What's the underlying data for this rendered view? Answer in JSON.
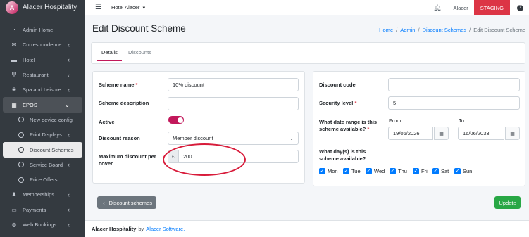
{
  "brand": {
    "name": "Alacer Hospitality"
  },
  "topbar": {
    "hotel": "Hotel Alacer",
    "user": "Alacer",
    "env_badge": "STAGING"
  },
  "sidebar": {
    "items": [
      {
        "label": "Admin Home",
        "icon": "gauge-icon"
      },
      {
        "label": "Correspondence",
        "icon": "envelope-icon"
      },
      {
        "label": "Hotel",
        "icon": "bed-icon"
      },
      {
        "label": "Restaurant",
        "icon": "utensils-icon"
      },
      {
        "label": "Spa and Leisure",
        "icon": "spa-icon"
      },
      {
        "label": "EPOS",
        "icon": "cash-register-icon"
      },
      {
        "label": "New device config",
        "icon": "circle-icon"
      },
      {
        "label": "Print Displays",
        "icon": "circle-icon"
      },
      {
        "label": "Discount Schemes",
        "icon": "circle-icon"
      },
      {
        "label": "Service Board",
        "icon": "circle-icon"
      },
      {
        "label": "Price Offers",
        "icon": "circle-icon"
      },
      {
        "label": "Memberships",
        "icon": "users-icon"
      },
      {
        "label": "Payments",
        "icon": "credit-card-icon"
      },
      {
        "label": "Web Bookings",
        "icon": "globe-icon"
      }
    ]
  },
  "page": {
    "title": "Edit Discount Scheme",
    "breadcrumb": [
      "Home",
      "Admin",
      "Discount Schemes",
      "Edit Discount Scheme"
    ]
  },
  "tabs": [
    "Details",
    "Discounts"
  ],
  "form_left": {
    "scheme_name_label": "Scheme name",
    "scheme_name_value": "10% discount",
    "scheme_description_label": "Scheme description",
    "scheme_description_value": "",
    "active_label": "Active",
    "discount_reason_label": "Discount reason",
    "discount_reason_value": "Member discount",
    "max_discount_label": "Maximum discount per cover",
    "currency_symbol": "£",
    "max_discount_value": "200"
  },
  "form_right": {
    "discount_code_label": "Discount code",
    "discount_code_value": "",
    "security_level_label": "Security level",
    "security_level_value": "5",
    "date_range_label": "What date range is this scheme available?",
    "from_label": "From",
    "from_value": "19/06/2026",
    "to_label": "To",
    "to_value": "16/06/2033",
    "days_label": "What day(s) is this scheme available?",
    "days": [
      "Mon",
      "Tue",
      "Wed",
      "Thu",
      "Fri",
      "Sat",
      "Sun"
    ]
  },
  "buttons": {
    "back": "Discount schemes",
    "update": "Update"
  },
  "footer": {
    "company": "Alacer Hospitality",
    "by": "by",
    "vendor": "Alacer Software."
  },
  "colors": {
    "accent": "#c2185b",
    "staging": "#dc3545",
    "update": "#28a745",
    "annotation": "#d81b3a"
  }
}
